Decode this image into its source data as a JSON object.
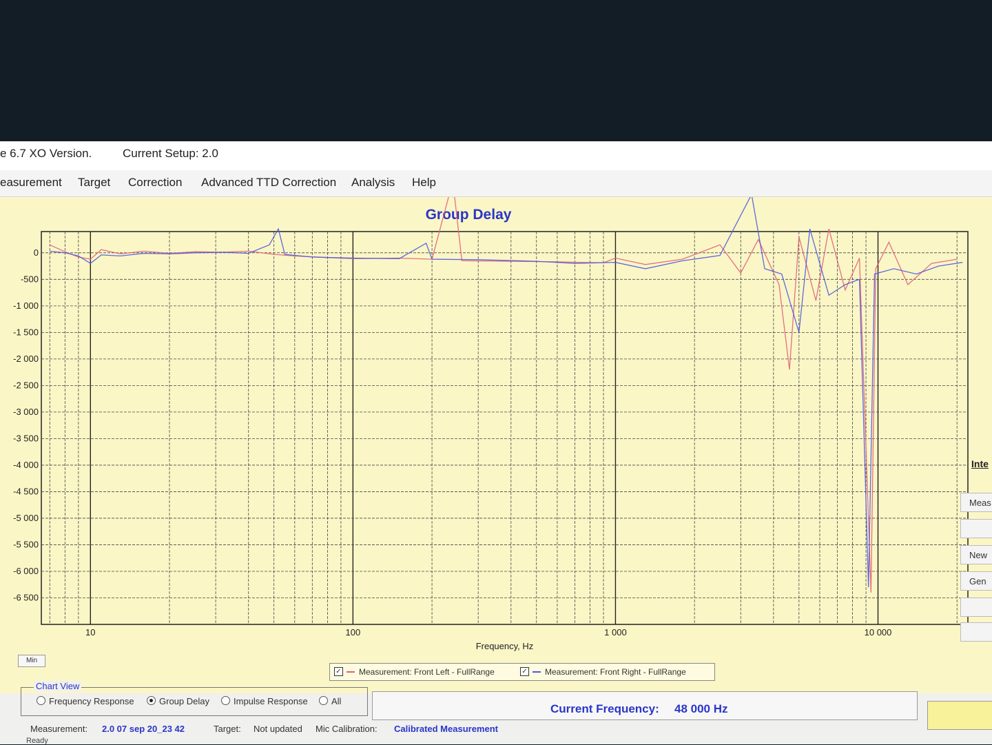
{
  "window": {
    "title": "e 6.7 XO Version.",
    "current_setup": "Current Setup: 2.0"
  },
  "menu": [
    "easurement",
    "Target",
    "Correction",
    "Advanced TTD Correction",
    "Analysis",
    "Help"
  ],
  "chart_data": {
    "type": "line",
    "title": "Group Delay",
    "xlabel": "Frequency, Hz",
    "ylabel": "",
    "x_scale": "log",
    "xlim": [
      6.5,
      22000
    ],
    "ylim": [
      -7000,
      400
    ],
    "x_ticks": [
      {
        "value": 10,
        "label": "10"
      },
      {
        "value": 100,
        "label": "100"
      },
      {
        "value": 1000,
        "label": "1 000"
      },
      {
        "value": 10000,
        "label": "10 000"
      }
    ],
    "y_ticks": [
      {
        "value": 0,
        "label": "0"
      },
      {
        "value": -500,
        "label": "-500"
      },
      {
        "value": -1000,
        "label": "-1 000"
      },
      {
        "value": -1500,
        "label": "-1 500"
      },
      {
        "value": -2000,
        "label": "-2 000"
      },
      {
        "value": -2500,
        "label": "-2 500"
      },
      {
        "value": -3000,
        "label": "-3 000"
      },
      {
        "value": -3500,
        "label": "-3 500"
      },
      {
        "value": -4000,
        "label": "-4 000"
      },
      {
        "value": -4500,
        "label": "-4 500"
      },
      {
        "value": -5000,
        "label": "-5 000"
      },
      {
        "value": -5500,
        "label": "-5 500"
      },
      {
        "value": -6000,
        "label": "-6 000"
      },
      {
        "value": -6500,
        "label": "-6 500"
      }
    ],
    "grid": true,
    "series": [
      {
        "name": "Measurement: Front Left - FullRange",
        "color": "#e0607a",
        "points": [
          [
            7,
            150
          ],
          [
            8,
            20
          ],
          [
            9,
            -80
          ],
          [
            10,
            -120
          ],
          [
            11,
            60
          ],
          [
            13,
            -20
          ],
          [
            16,
            30
          ],
          [
            20,
            -10
          ],
          [
            25,
            20
          ],
          [
            32,
            10
          ],
          [
            40,
            30
          ],
          [
            50,
            -30
          ],
          [
            60,
            -60
          ],
          [
            80,
            -90
          ],
          [
            100,
            -110
          ],
          [
            150,
            -100
          ],
          [
            200,
            -120
          ],
          [
            240,
            1350
          ],
          [
            260,
            -150
          ],
          [
            400,
            -160
          ],
          [
            600,
            -170
          ],
          [
            900,
            -190
          ],
          [
            1000,
            -100
          ],
          [
            1300,
            -220
          ],
          [
            1800,
            -120
          ],
          [
            2500,
            150
          ],
          [
            3000,
            -380
          ],
          [
            3500,
            250
          ],
          [
            4200,
            -600
          ],
          [
            4600,
            -2200
          ],
          [
            5000,
            300
          ],
          [
            5800,
            -900
          ],
          [
            6500,
            450
          ],
          [
            7500,
            -700
          ],
          [
            8500,
            -100
          ],
          [
            9400,
            -6400
          ],
          [
            9800,
            -300
          ],
          [
            11000,
            200
          ],
          [
            13000,
            -600
          ],
          [
            16000,
            -200
          ],
          [
            20000,
            -120
          ]
        ]
      },
      {
        "name": "Measurement: Front Right - FullRange",
        "color": "#4a5ae0",
        "points": [
          [
            7,
            30
          ],
          [
            8,
            0
          ],
          [
            9,
            -60
          ],
          [
            10,
            -200
          ],
          [
            11,
            -40
          ],
          [
            13,
            -60
          ],
          [
            16,
            -10
          ],
          [
            20,
            -20
          ],
          [
            25,
            0
          ],
          [
            32,
            10
          ],
          [
            40,
            -10
          ],
          [
            48,
            150
          ],
          [
            52,
            450
          ],
          [
            55,
            -30
          ],
          [
            70,
            -80
          ],
          [
            100,
            -100
          ],
          [
            150,
            -110
          ],
          [
            190,
            180
          ],
          [
            200,
            -120
          ],
          [
            300,
            -130
          ],
          [
            500,
            -160
          ],
          [
            700,
            -200
          ],
          [
            1000,
            -180
          ],
          [
            1300,
            -300
          ],
          [
            1800,
            -150
          ],
          [
            2500,
            -50
          ],
          [
            3300,
            1100
          ],
          [
            3700,
            -300
          ],
          [
            4300,
            -400
          ],
          [
            5000,
            -1500
          ],
          [
            5500,
            450
          ],
          [
            6500,
            -800
          ],
          [
            7500,
            -600
          ],
          [
            8500,
            -500
          ],
          [
            9200,
            -6300
          ],
          [
            9700,
            -400
          ],
          [
            11500,
            -300
          ],
          [
            14000,
            -400
          ],
          [
            17000,
            -250
          ],
          [
            21000,
            -180
          ]
        ]
      }
    ]
  },
  "legend": {
    "left_label": "Measurement: Front Left - FullRange",
    "right_label": "Measurement: Front Right - FullRange"
  },
  "min_button": "Min",
  "right_panel": {
    "header": "Inte",
    "buttons": [
      "Meas",
      "",
      "New ",
      "Gen",
      "",
      ""
    ]
  },
  "chart_view": {
    "title": "Chart View",
    "options": [
      {
        "label": "Frequency Response",
        "selected": false
      },
      {
        "label": "Group Delay",
        "selected": true
      },
      {
        "label": "Impulse Response",
        "selected": false
      },
      {
        "label": "All",
        "selected": false
      }
    ]
  },
  "current_frequency": {
    "label": "Current Frequency:",
    "value": "48 000 Hz"
  },
  "status": {
    "measurement_label": "Measurement:",
    "measurement_value": "2.0 07 sep 20_23 42",
    "target_label": "Target:",
    "target_value": "Not updated",
    "mic_label": "Mic Calibration:",
    "mic_value": "Calibrated Measurement",
    "ready": "Ready"
  }
}
